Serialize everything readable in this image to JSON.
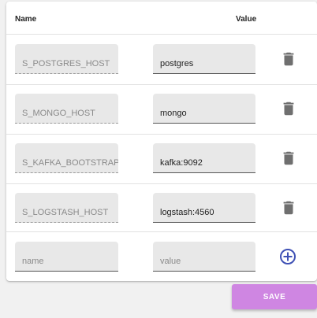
{
  "table": {
    "header_name": "Name",
    "header_value": "Value",
    "rows": [
      {
        "name": "S_POSTGRES_HOST",
        "value": "postgres"
      },
      {
        "name": "S_MONGO_HOST",
        "value": "mongo"
      },
      {
        "name": "S_KAFKA_BOOTSTRAP",
        "value": "kafka:9092"
      },
      {
        "name": "S_LOGSTASH_HOST",
        "value": "logstash:4560"
      }
    ],
    "new_row": {
      "name_placeholder": "name",
      "value_placeholder": "value"
    }
  },
  "icons": {
    "delete": "trash-icon",
    "add": "add-circle-icon"
  },
  "colors": {
    "save_button": "#cf86e2",
    "add_icon": "#3f51b5",
    "delete_icon": "#6f6f6f"
  },
  "save_label": "SAVE"
}
